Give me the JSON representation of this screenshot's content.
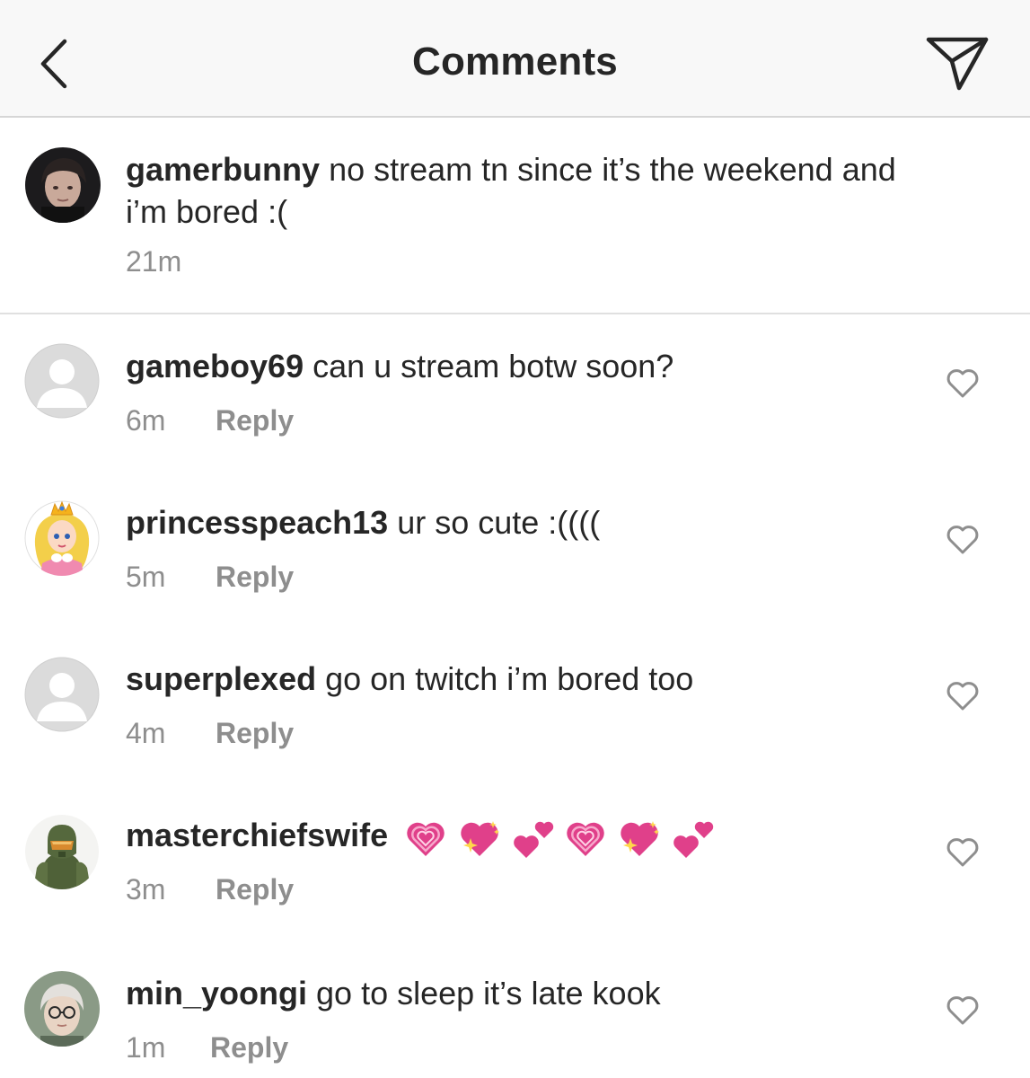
{
  "header": {
    "title": "Comments",
    "back_icon": "chevron-left-icon",
    "send_icon": "paper-plane-icon"
  },
  "caption": {
    "username": "gamerbunny",
    "text_line1": "no stream tn since it’s the weekend and",
    "text_line2": "i’m bored :(",
    "time": "21m"
  },
  "comments": [
    {
      "username": "gameboy69",
      "text": "can u stream botw soon?",
      "time": "6m",
      "reply": "Reply",
      "avatar": "default"
    },
    {
      "username": "princesspeach13",
      "text": "ur so cute :((((",
      "time": "5m",
      "reply": "Reply",
      "avatar": "peach"
    },
    {
      "username": "superplexed",
      "text": "go on twitch i’m bored too",
      "time": "4m",
      "reply": "Reply",
      "avatar": "default"
    },
    {
      "username": "masterchiefswife",
      "text": "",
      "emojis": [
        "heart-icon",
        "sparkling-heart-icon",
        "two-hearts-icon",
        "heart-icon",
        "sparkling-heart-icon",
        "two-hearts-icon"
      ],
      "time": "3m",
      "reply": "Reply",
      "avatar": "masterchief"
    },
    {
      "username": "min_yoongi",
      "text": "go to sleep it’s late kook",
      "time": "1m",
      "reply": "Reply",
      "avatar": "photo"
    }
  ],
  "colors": {
    "text": "#262626",
    "secondary": "#8e8e8e",
    "header_bg": "#f8f8f8",
    "emoji_pink": "#e0408a"
  }
}
